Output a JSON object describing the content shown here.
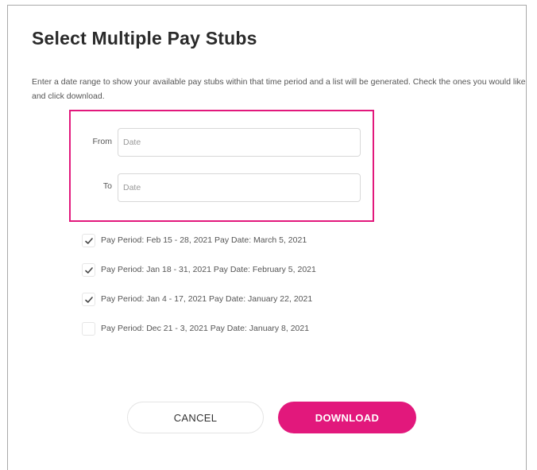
{
  "dialog": {
    "title": "Select Multiple Pay Stubs",
    "description": "Enter a date range to show your available pay stubs within that time period and a list will be generated. Check the ones you would like and click download."
  },
  "date_range": {
    "from_label": "From",
    "from_placeholder": "Date",
    "from_value": "",
    "to_label": "To",
    "to_placeholder": "Date",
    "to_value": ""
  },
  "pay_stubs": [
    {
      "label": "Pay Period: Feb 15 - 28, 2021 Pay Date: March 5, 2021",
      "checked": true
    },
    {
      "label": "Pay Period: Jan 18 - 31, 2021 Pay Date: February 5, 2021",
      "checked": true
    },
    {
      "label": "Pay Period: Jan 4 - 17, 2021 Pay Date: January 22, 2021",
      "checked": true
    },
    {
      "label": "Pay Period: Dec 21 - 3, 2021 Pay Date: January 8, 2021",
      "checked": false
    }
  ],
  "actions": {
    "cancel_label": "CANCEL",
    "download_label": "DOWNLOAD"
  },
  "colors": {
    "accent": "#e2187c",
    "checkmark": "#444444",
    "border": "#a9a9a9"
  },
  "icons": {
    "checkbox_checked": "checkmark-icon"
  }
}
